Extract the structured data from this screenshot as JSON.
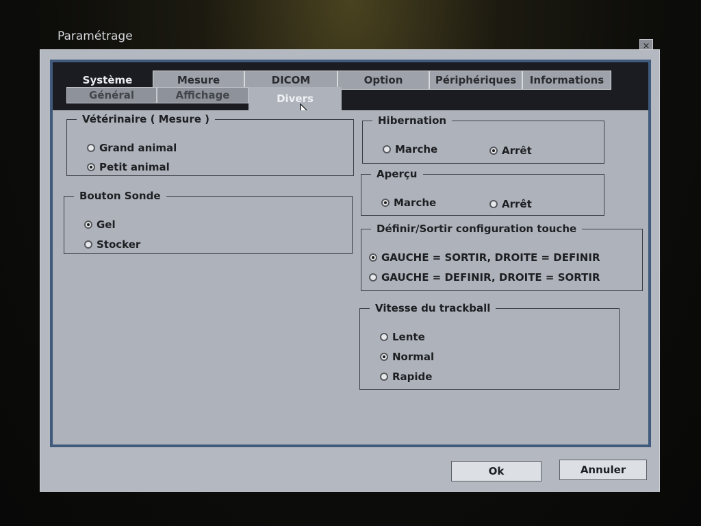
{
  "window": {
    "title": "Paramétrage",
    "close_glyph": "×"
  },
  "tabs": [
    {
      "label": "Système",
      "active": true
    },
    {
      "label": "Mesure",
      "active": false
    },
    {
      "label": "DICOM",
      "active": false
    },
    {
      "label": "Option",
      "active": false
    },
    {
      "label": "Périphériques",
      "active": false
    },
    {
      "label": "Informations",
      "active": false
    }
  ],
  "subtabs": [
    {
      "label": "Général",
      "active": false
    },
    {
      "label": "Affichage",
      "active": false
    },
    {
      "label": "Divers",
      "active": true
    }
  ],
  "groups": {
    "veterinaire": {
      "title": "Vétérinaire ( Mesure )",
      "options": [
        {
          "label": "Grand animal",
          "selected": false
        },
        {
          "label": "Petit animal",
          "selected": true
        }
      ]
    },
    "bouton_sonde": {
      "title": "Bouton Sonde",
      "options": [
        {
          "label": "Gel",
          "selected": true
        },
        {
          "label": "Stocker",
          "selected": false
        }
      ]
    },
    "hibernation": {
      "title": "Hibernation",
      "options": [
        {
          "label": "Marche",
          "selected": false
        },
        {
          "label": "Arrêt",
          "selected": true
        }
      ]
    },
    "apercu": {
      "title": "Aperçu",
      "options": [
        {
          "label": "Marche",
          "selected": true
        },
        {
          "label": "Arrêt",
          "selected": false
        }
      ]
    },
    "config_touche": {
      "title": "Définir/Sortir configuration touche",
      "options": [
        {
          "label": "GAUCHE = SORTIR, DROITE = DEFINIR",
          "selected": true
        },
        {
          "label": "GAUCHE = DEFINIR, DROITE = SORTIR",
          "selected": false
        }
      ]
    },
    "trackball": {
      "title": "Vitesse du trackball",
      "options": [
        {
          "label": "Lente",
          "selected": false
        },
        {
          "label": "Normal",
          "selected": true
        },
        {
          "label": "Rapide",
          "selected": false
        }
      ]
    }
  },
  "buttons": {
    "ok": "Ok",
    "cancel": "Annuler"
  },
  "icons": {
    "cursor": "mouse-pointer-icon",
    "close": "close-icon"
  }
}
